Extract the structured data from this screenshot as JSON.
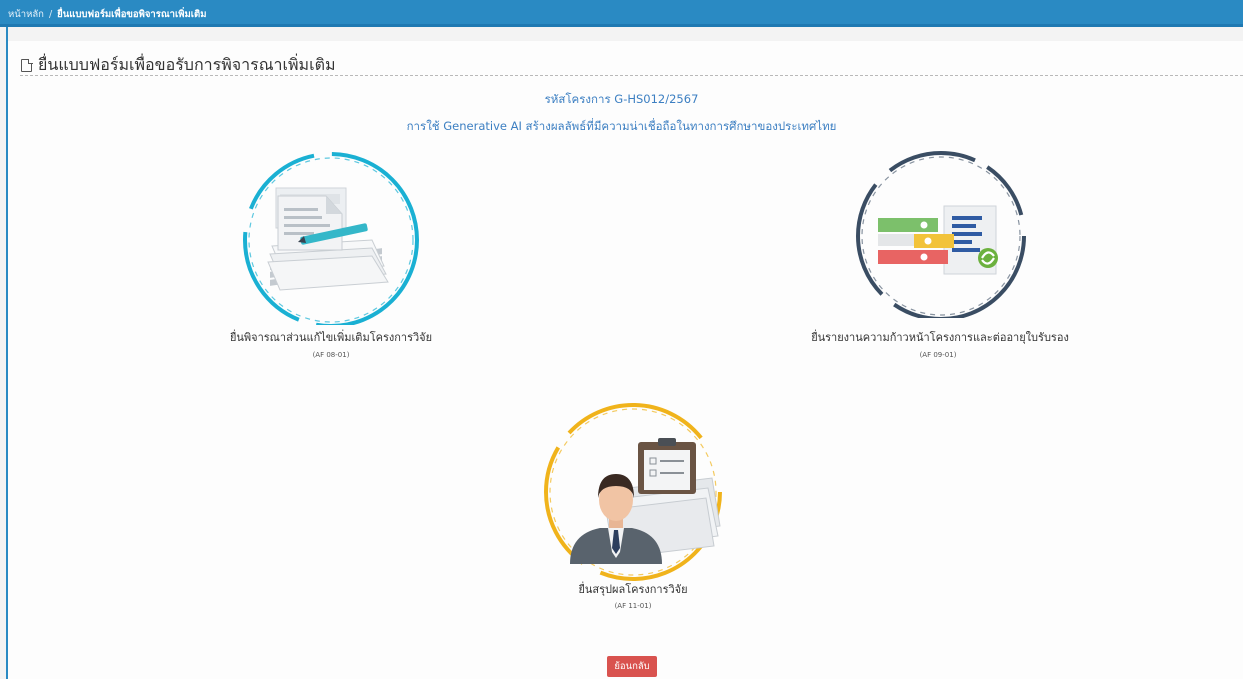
{
  "breadcrumb": {
    "home": "หน้าหลัก",
    "separator": "/",
    "current": "ยื่นแบบฟอร์มเพื่อขอพิจารณาเพิ่มเติม"
  },
  "page": {
    "title": "ยื่นแบบฟอร์มเพื่อขอรับการพิจารณาเพิ่มเติม",
    "title_icon": "file-icon"
  },
  "project": {
    "code": "รหัสโครงการ G-HS012/2567",
    "name": "การใช้ Generative AI สร้างผลลัพธ์ที่มีความน่าเชื่อถือในทางการศึกษาของประเทศไทย"
  },
  "cards": [
    {
      "label": "ยื่นพิจารณาส่วนแก้ไขเพิ่มเติมโครงการวิจัย",
      "code": "(AF 08-01)",
      "icon": "document-pen-icon",
      "ring_color": "#1ab0d3"
    },
    {
      "label": "ยื่นรายงานความก้าวหน้าโครงการและต่ออายุใบรับรอง",
      "code": "(AF 09-01)",
      "icon": "report-binders-icon",
      "ring_color": "#3a4d63"
    },
    {
      "label": "ยื่นสรุปผลโครงการวิจัย",
      "code": "(AF 11-01)",
      "icon": "researcher-clipboard-icon",
      "ring_color": "#f0b31b"
    }
  ],
  "actions": {
    "back_label": "ย้อนกลับ"
  },
  "colors": {
    "header": "#2a8ac3",
    "link": "#3c7fc2",
    "back_button": "#d9534f"
  }
}
